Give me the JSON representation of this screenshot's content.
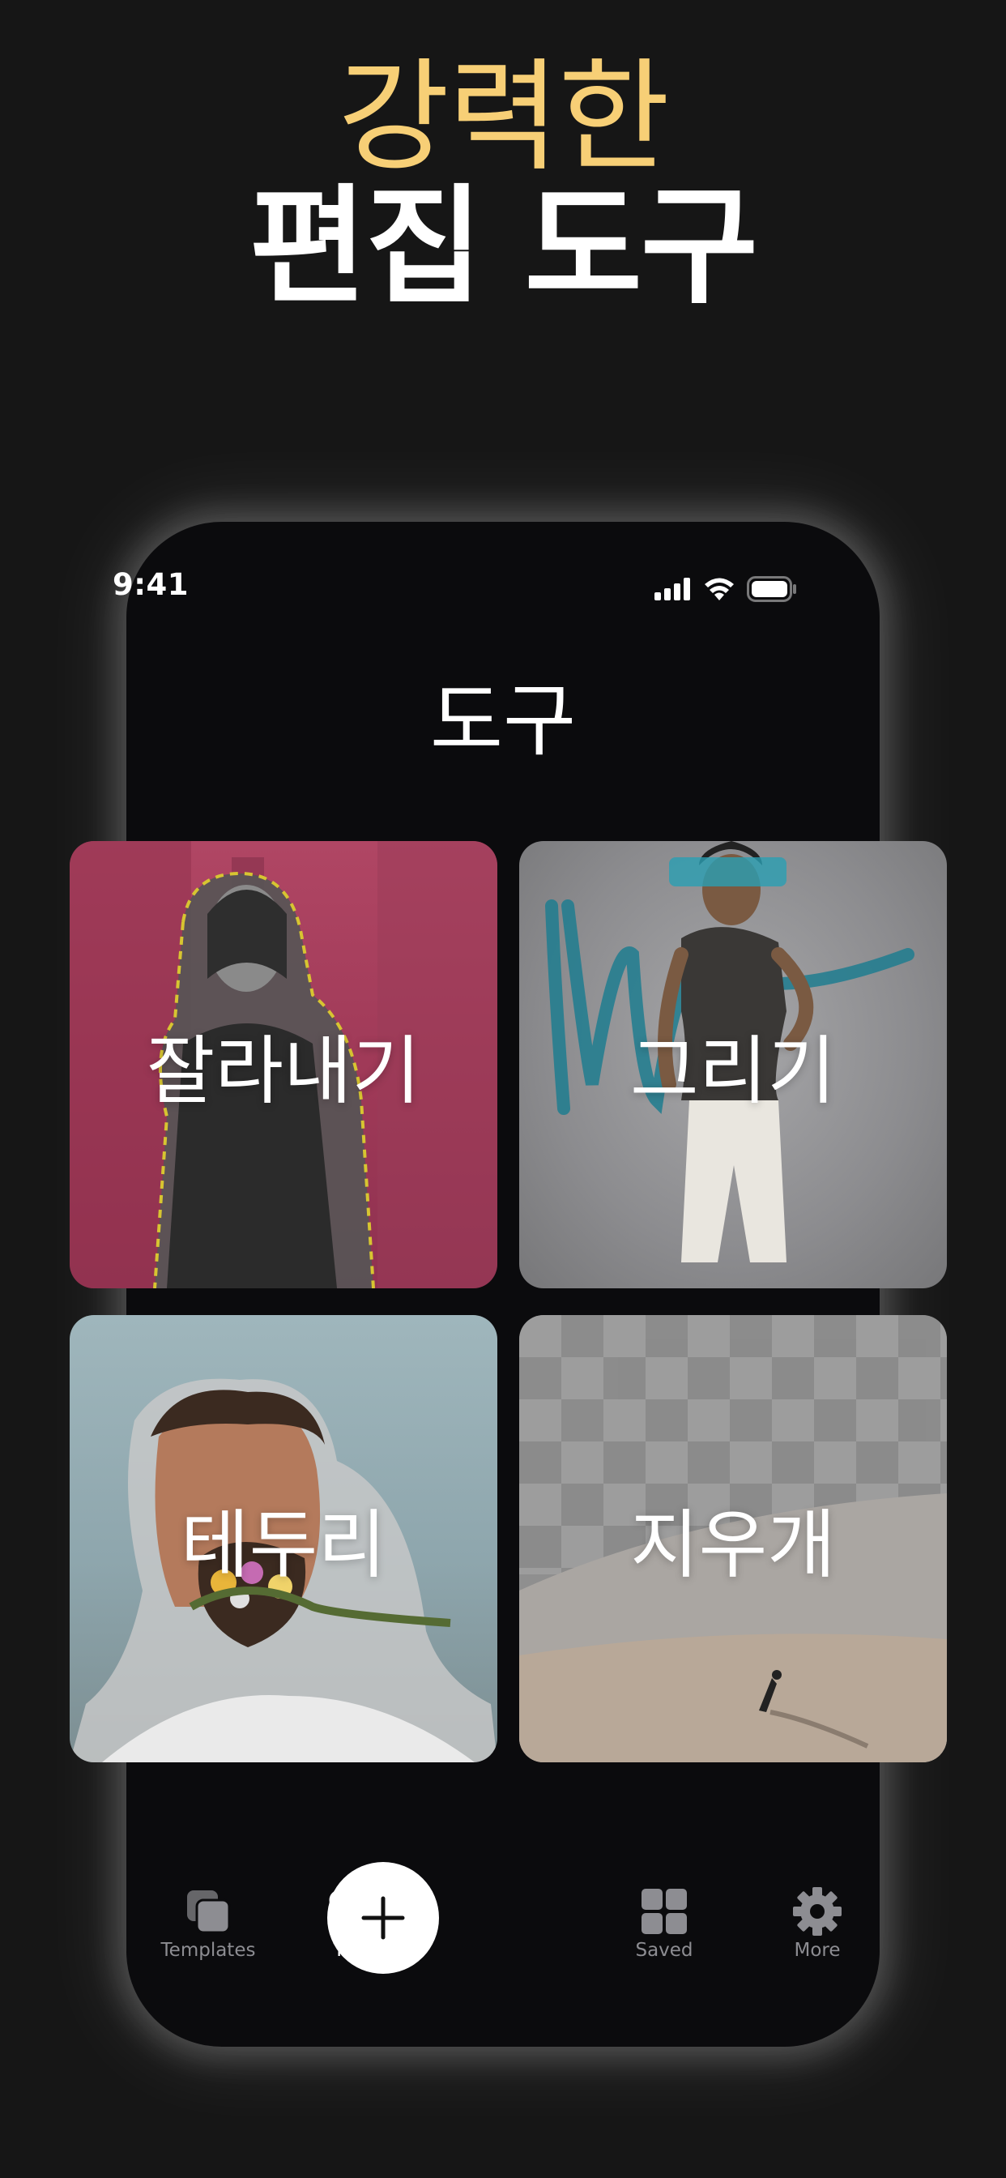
{
  "headline": {
    "line1": "강력한",
    "line2": "편집 도구"
  },
  "status": {
    "time": "9:41"
  },
  "screen": {
    "title": "도구"
  },
  "tools": [
    {
      "label": "잘라내기"
    },
    {
      "label": "그리기"
    },
    {
      "label": "테두리"
    },
    {
      "label": "지우개"
    }
  ],
  "tabbar": {
    "templates": "Templates",
    "tools": "Tools",
    "saved": "Saved",
    "more": "More"
  },
  "colors": {
    "accent": "#f7cf76",
    "background": "#161616",
    "phone": "#0b0b0d"
  }
}
